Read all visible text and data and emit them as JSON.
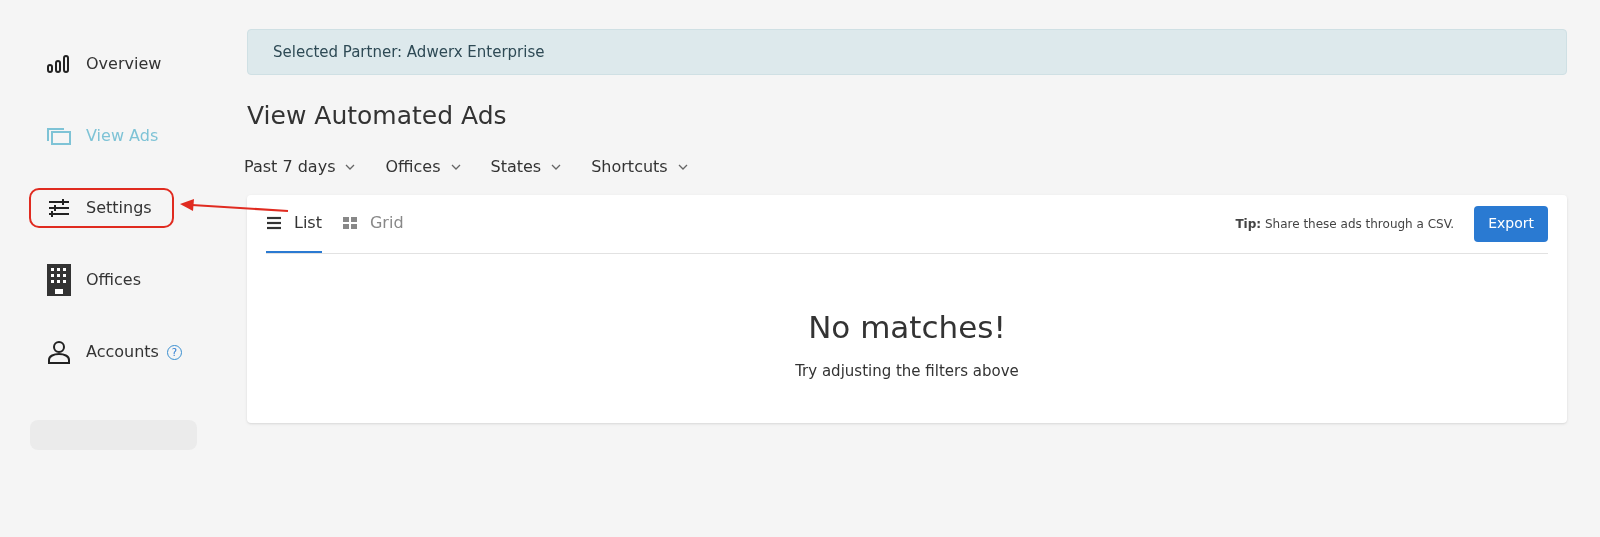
{
  "sidebar": {
    "items": [
      {
        "kind": "chart",
        "label": "Overview",
        "selected": false,
        "highlighted": false
      },
      {
        "kind": "ads",
        "label": "View Ads",
        "selected": true,
        "highlighted": false
      },
      {
        "kind": "sliders",
        "label": "Settings",
        "selected": false,
        "highlighted": true
      },
      {
        "kind": "building",
        "label": "Offices",
        "selected": false,
        "highlighted": false
      },
      {
        "kind": "person",
        "label": "Accounts",
        "selected": false,
        "highlighted": false,
        "help": "?"
      }
    ]
  },
  "banner": "Selected Partner: Adwerx Enterprise",
  "title": "View Automated Ads",
  "filters": [
    "Past 7 days",
    "Offices",
    "States",
    "Shortcuts"
  ],
  "tabs": [
    {
      "kind": "list",
      "label": "List",
      "selected": true
    },
    {
      "kind": "grid",
      "label": "Grid",
      "selected": false
    }
  ],
  "tip": "**Tip:** Share these ads through a CSV.",
  "export_button": "Export",
  "empty_state": {
    "heading": "No matches!",
    "message": "Try adjusting the filters above"
  }
}
